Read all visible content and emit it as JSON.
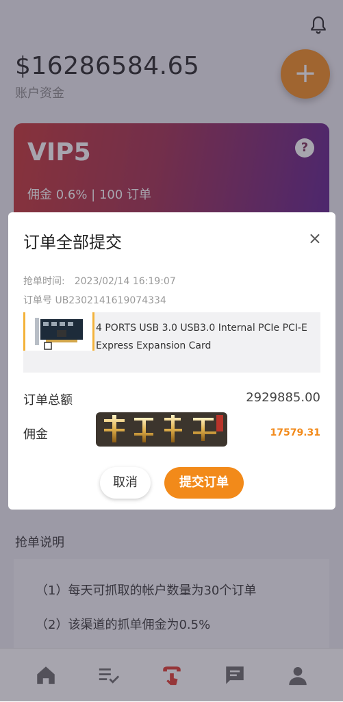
{
  "header": {
    "balance": "$16286584.65",
    "balance_label": "账户资金",
    "fab_label": "+"
  },
  "vip": {
    "title": "VIP5",
    "help": "?",
    "subtitle": "佣金 0.6% | 100 订单"
  },
  "intro": {
    "title": "抢单说明",
    "lines": [
      "（1）每天可抓取的帐户数量为30个订单",
      "（2）该渠道的抓单佣金为0.5%"
    ]
  },
  "modal": {
    "title": "订单全部提交",
    "close": "×",
    "time_label": "抢单时间:",
    "time_value": "2023/02/14 16:19:07",
    "order_label": "订单号",
    "order_value": "UB2302141619074334",
    "product_name": "4 PORTS USB 3.0 USB3.0 Internal PCIe PCI-E Express Expansion Card",
    "total_label": "订单总额",
    "total_value": "2929885.00",
    "commission_label": "佣金",
    "commission_value": "17579.31",
    "cancel_label": "取消",
    "submit_label": "提交订单"
  },
  "watermark": {
    "text": "南豆科技"
  },
  "tabbar": {
    "icons": [
      "home-icon",
      "list-check-icon",
      "grab-order-icon",
      "message-icon",
      "user-icon"
    ]
  },
  "colors": {
    "accent": "#f28a1a",
    "vip_gradient_start": "#c52f2f",
    "vip_gradient_end": "#5a1a8a"
  }
}
